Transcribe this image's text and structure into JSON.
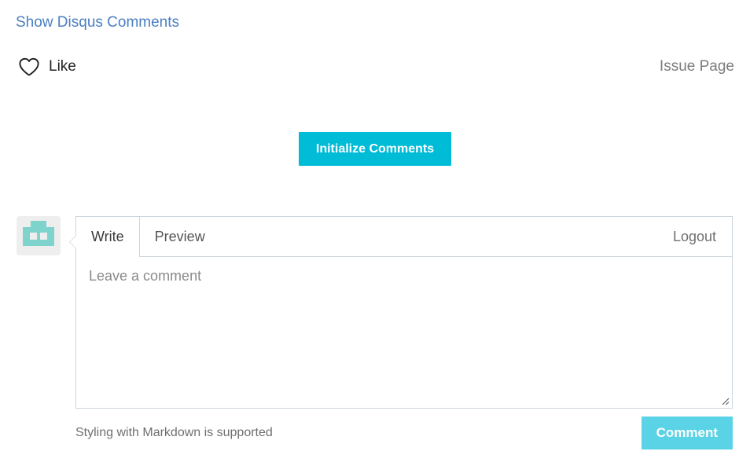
{
  "disqus": {
    "toggle_label": "Show Disqus Comments"
  },
  "reactions": {
    "like_label": "Like",
    "heart_icon": "heart-outline-icon",
    "issue_page_label": "Issue Page"
  },
  "init": {
    "button_label": "Initialize Comments"
  },
  "avatar": {
    "icon": "identicon-avatar",
    "bg_color": "#eeeeee",
    "fg_color": "#7ed3cd"
  },
  "editor": {
    "tabs": [
      {
        "label": "Write",
        "active": true
      },
      {
        "label": "Preview",
        "active": false
      }
    ],
    "logout_label": "Logout",
    "input_value": "",
    "input_placeholder": "Leave a comment",
    "markdown_note": "Styling with Markdown is supported",
    "submit_label": "Comment"
  },
  "colors": {
    "link_blue": "#4a7fc1",
    "accent_cyan": "#00bcd7",
    "accent_cyan_disabled": "#5bd3e6",
    "border_gray": "#cdd6dd",
    "muted_text": "#6f6f6f"
  }
}
